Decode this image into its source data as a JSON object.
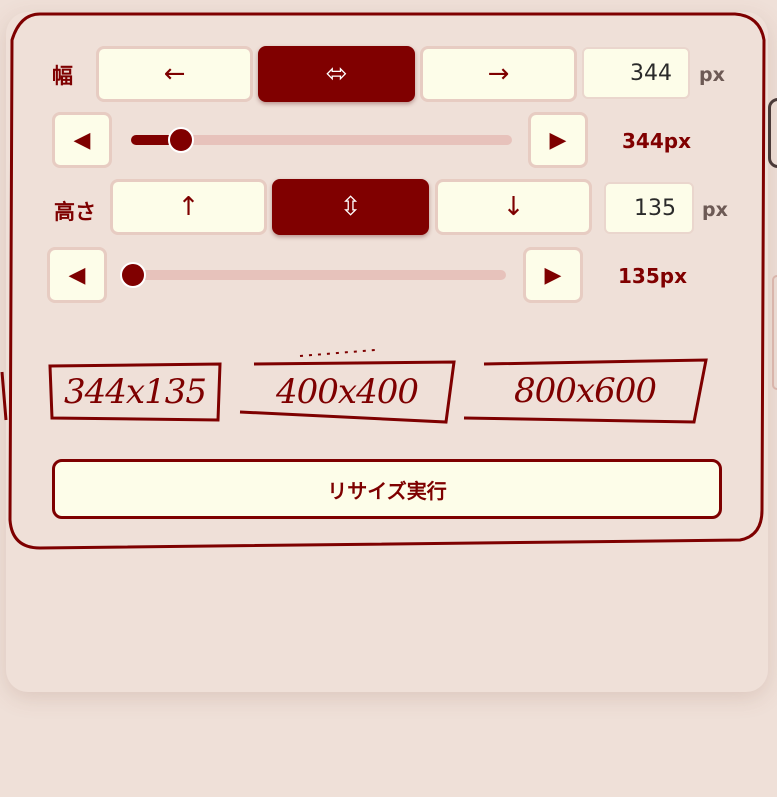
{
  "width": {
    "label": "幅",
    "buttons": [
      {
        "label": "←",
        "active": false
      },
      {
        "label": "⬄",
        "active": true
      },
      {
        "label": "→",
        "active": false
      }
    ],
    "input_value": "344",
    "unit": "px",
    "step_left": "◀",
    "step_right": "▶",
    "slider_fraction": 0.13,
    "display_value": "344px"
  },
  "height": {
    "label": "高さ",
    "buttons": [
      {
        "label": "↑",
        "active": false
      },
      {
        "label": "⇳",
        "active": true
      },
      {
        "label": "↓",
        "active": false
      }
    ],
    "input_value": "135",
    "unit": "px",
    "step_left": "◀",
    "step_right": "▶",
    "slider_fraction": 0.0,
    "display_value": "135px"
  },
  "presets": [
    "344x135",
    "400x400",
    "800x600"
  ],
  "execute_label": "リサイズ実行",
  "colors": {
    "accent": "#800000",
    "background": "#efe0d8",
    "button": "#fdfde9"
  }
}
